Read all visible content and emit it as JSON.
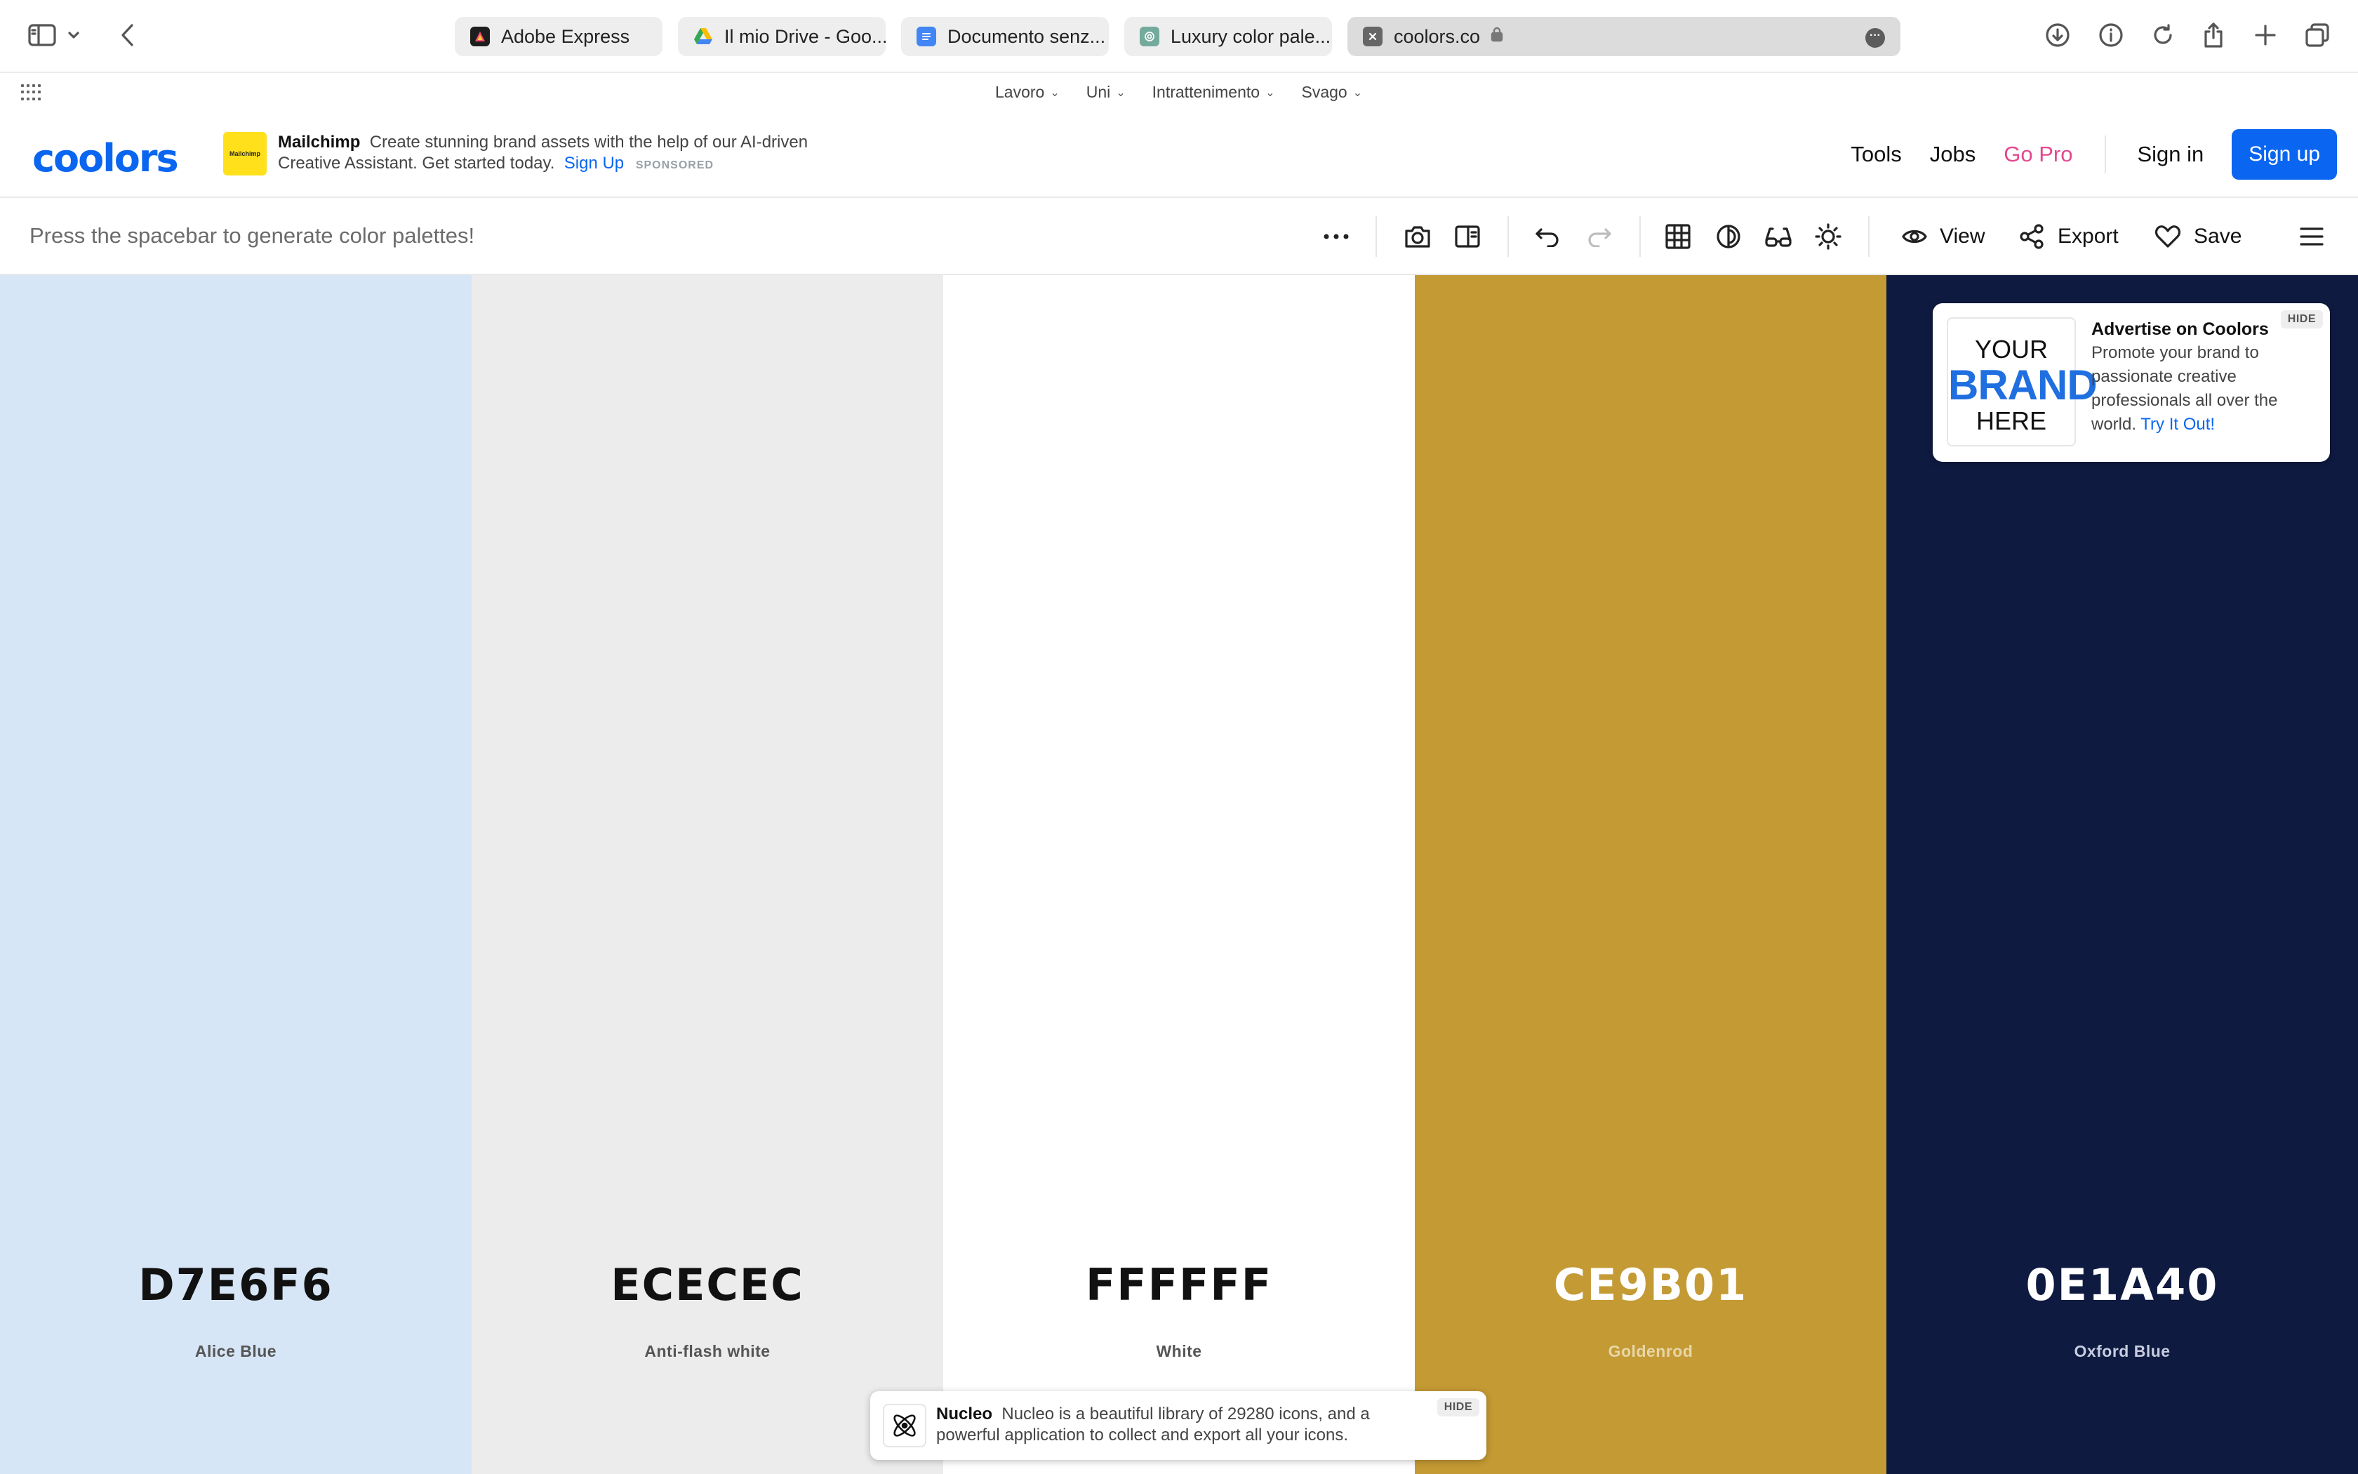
{
  "browser": {
    "tabs": [
      {
        "title": "Adobe Express",
        "favicon": "adobe-express-icon",
        "color": "#1e1e1e"
      },
      {
        "title": "Il mio Drive - Goo...",
        "favicon": "google-drive-icon",
        "color": "#34a853"
      },
      {
        "title": "Documento senz...",
        "favicon": "google-docs-icon",
        "color": "#4285f4"
      },
      {
        "title": "Luxury color pale...",
        "favicon": "chatgpt-icon",
        "color": "#74aa9c"
      }
    ],
    "active_tab": {
      "title": "coolors.co",
      "favicon": "close-icon"
    }
  },
  "bookmarks": {
    "items": [
      {
        "label": "Lavoro"
      },
      {
        "label": "Uni"
      },
      {
        "label": "Intrattenimento"
      },
      {
        "label": "Svago"
      }
    ]
  },
  "header": {
    "logo": "coolors",
    "ad": {
      "brand": "Mailchimp",
      "text": "Create stunning brand assets with the help of our AI-driven Creative Assistant. Get started today.",
      "link": "Sign Up",
      "sponsored": "SPONSORED",
      "thumb_color": "#ffe01b"
    },
    "nav": {
      "tools": "Tools",
      "jobs": "Jobs",
      "go_pro": "Go Pro",
      "sign_in": "Sign in",
      "sign_up": "Sign up"
    },
    "accent": "#0a66f0",
    "pro_color": "#e5488e"
  },
  "toolbar": {
    "hint": "Press the spacebar to generate color palettes!",
    "view": "View",
    "export": "Export",
    "save": "Save"
  },
  "palette": [
    {
      "hex": "D7E6F6",
      "name": "Alice Blue",
      "bg": "#D7E6F6",
      "fg": "#111111",
      "name_fg": "#555555"
    },
    {
      "hex": "ECECEC",
      "name": "Anti-flash white",
      "bg": "#ECECEC",
      "fg": "#111111",
      "name_fg": "#555555"
    },
    {
      "hex": "FFFFFF",
      "name": "White",
      "bg": "#FFFFFF",
      "fg": "#111111",
      "name_fg": "#555555"
    },
    {
      "hex": "CE9B01",
      "name": "Goldenrod",
      "bg": "#C49A34",
      "fg": "#ffffff",
      "name_fg": "#e8d6a8"
    },
    {
      "hex": "0E1A40",
      "name": "Oxford Blue",
      "bg": "#0E1A40",
      "fg": "#ffffff",
      "name_fg": "#c8cde0"
    }
  ],
  "advert": {
    "brand_line1": "YOUR",
    "brand_line2": "BRAND",
    "brand_line3": "HERE",
    "title": "Advertise on Coolors",
    "text": "Promote your brand to passionate creative professionals all over the world.",
    "link": "Try It Out!",
    "hide": "HIDE"
  },
  "bottom_ad": {
    "brand": "Nucleo",
    "text": "Nucleo is a beautiful library of 29280 icons, and a powerful application to collect and export all your icons.",
    "hide": "HIDE"
  }
}
